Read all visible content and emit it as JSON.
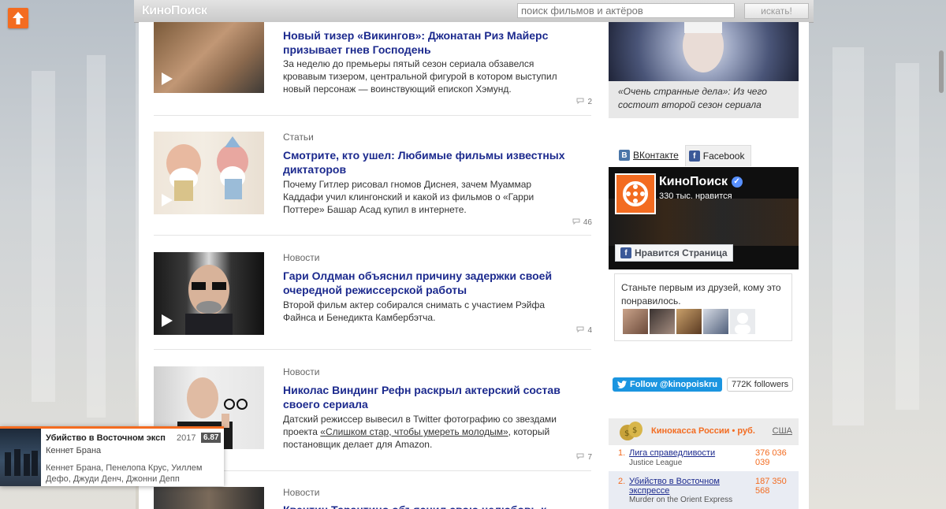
{
  "site": {
    "logo": "КиноПоиск",
    "accent": "#f36c21",
    "link": "#1c2a8e"
  },
  "search": {
    "placeholder": "поиск фильмов и актёров",
    "button": "искать!"
  },
  "news": [
    {
      "category": "",
      "title": "Новый тизер «Викингов»: Джонатан Риз Майерс призывает гнев Господень",
      "desc": "За неделю до премьеры пятый сезон сериала обзавелся кровавым тизером, центральной фигурой в котором выступил новый персонаж — воинствующий епископ Хэмунд.",
      "comments": "2"
    },
    {
      "category": "Статьи",
      "title": "Смотрите, кто ушел: Любимые фильмы известных диктаторов",
      "desc": "Почему Гитлер рисовал гномов Диснея, зачем Муаммар Каддафи учил клингонский и какой из фильмов о «Гарри Поттере» Башар Асад купил в интернете.",
      "comments": "46"
    },
    {
      "category": "Новости",
      "title": "Гари Олдман объяснил причину задержки своей очередной режиссерской работы",
      "desc": "Второй фильм актер собирался снимать с участием Рэйфа Файнса и Бенедикта Камбербэтча.",
      "comments": "4"
    },
    {
      "category": "Новости",
      "title": "Николас Виндинг Рефн раскрыл актерский состав своего сериала",
      "desc_before": "Датский режиссер вывесил в Twitter фотографию со звездами проекта ",
      "desc_link": "«Слишком стар, чтобы умереть молодым»",
      "desc_after": ", который постановщик делает для Amazon.",
      "comments": "7"
    },
    {
      "category": "Новости",
      "title": "Квентин Тарантино объяснил свою нелюбовь к"
    }
  ],
  "featured": {
    "caption": "«Очень странные дела»: Из чего состоит второй сезон сериала"
  },
  "social": {
    "vk_tab": "ВКонтакте",
    "fb_tab": "Facebook",
    "fb_page_name": "КиноПоиск",
    "fb_likes": "330 тыс. нравится",
    "fb_like_button": "Нравится Страница",
    "fb_friends_text": "Станьте первым из друзей, кому это понравилось.",
    "twitter_button": "Follow @kinopoiskru",
    "twitter_followers": "772K followers"
  },
  "boxoffice": {
    "title": "Кинокасса России • руб.",
    "usa_link": "США",
    "rows": [
      {
        "num": "1.",
        "title": "Лига справедливости",
        "orig": "Justice League",
        "gross": "376 036 039"
      },
      {
        "num": "2.",
        "title": "Убийство в Восточном экспрессе",
        "orig": "Murder on the Orient Express",
        "gross": "187 350 568"
      }
    ]
  },
  "popup": {
    "title": "Убийство в Восточном экспрессе",
    "year": "2017",
    "rating": "6.87",
    "director": "Кеннет Брана",
    "cast": "Кеннет Брана, Пенелопа Крус, Уиллем Дефо, Джуди Денч, Джонни Депп"
  }
}
